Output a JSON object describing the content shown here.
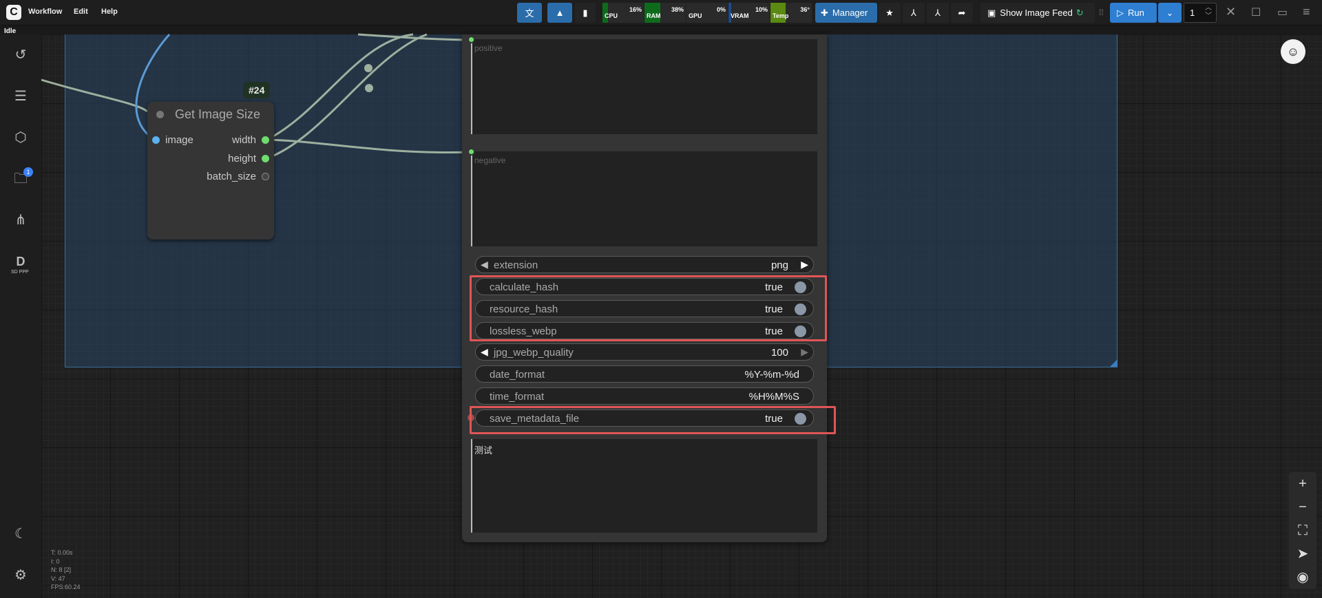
{
  "menu": {
    "logo": "C",
    "items": [
      "Workflow",
      "Edit",
      "Help"
    ]
  },
  "status": "Idle",
  "monitors": [
    {
      "label": "CPU",
      "value": "16%",
      "level": 0.16
    },
    {
      "label": "RAM",
      "value": "38%",
      "level": 0.38
    },
    {
      "label": "GPU",
      "value": "0%",
      "level": 0.0
    },
    {
      "label": "VRAM",
      "value": "10%",
      "level": 0.1
    },
    {
      "label": "Temp",
      "value": "36°",
      "level": 0.36
    }
  ],
  "toolbar": {
    "manager_label": "Manager",
    "image_feed_label": "Show Image Feed",
    "run_label": "Run",
    "batch_count": "1"
  },
  "sidebar": {
    "queue_badge": "1",
    "sdppp_label": "SD PPP"
  },
  "node24": {
    "badge": "#24",
    "title": "Get Image Size",
    "input": "image",
    "outputs": [
      "width",
      "height",
      "batch_size"
    ]
  },
  "save_node": {
    "positive_placeholder": "positive",
    "negative_placeholder": "negative",
    "widgets": [
      {
        "name": "extension",
        "value": "png"
      },
      {
        "name": "calculate_hash",
        "value": "true"
      },
      {
        "name": "resource_hash",
        "value": "true"
      },
      {
        "name": "lossless_webp",
        "value": "true"
      },
      {
        "name": "jpg_webp_quality",
        "value": "100"
      },
      {
        "name": "date_format",
        "value": "%Y-%m-%d"
      },
      {
        "name": "time_format",
        "value": "%H%M%S"
      },
      {
        "name": "save_metadata_file",
        "value": "true"
      }
    ],
    "notes_text": "测试"
  },
  "stats": [
    "T: 0.00s",
    "I: 0",
    "N: 8 [2]",
    "V: 47",
    "FPS:60.24"
  ],
  "colors": {
    "accent": "#3b82f6",
    "highlight": "#e05555",
    "group": "#3a6e9c",
    "link": "#9fb09f"
  }
}
